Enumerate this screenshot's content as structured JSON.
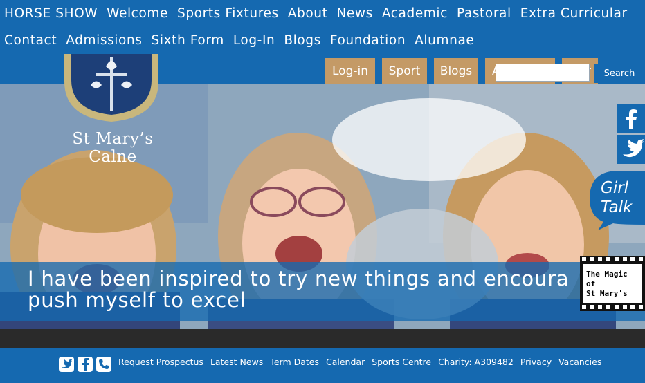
{
  "nav": {
    "row1": [
      "HORSE SHOW",
      "Welcome",
      "Sports Fixtures",
      "About",
      "News",
      "Academic",
      "Pastoral",
      "Extra Curricular"
    ],
    "row2": [
      "Contact",
      "Admissions",
      "Sixth Form",
      "Log-In",
      "Blogs",
      "Foundation",
      "Alumnae"
    ]
  },
  "quick_tabs": [
    "Log-in",
    "Sport",
    "Blogs",
    "A",
    "r"
  ],
  "search": {
    "button_label": "Search",
    "value": ""
  },
  "crest": {
    "line1": "St Mary’s",
    "line2": "Calne"
  },
  "hero": {
    "caption_line1": "I have been inspired to try new things and encoura",
    "caption_line2": "push myself to excel"
  },
  "side": {
    "girl_talk_line1": "Girl",
    "girl_talk_line2": "Talk",
    "magic_line1": "The Magic of",
    "magic_line2": "St Mary's"
  },
  "footer": {
    "links": [
      "Request Prospectus",
      "Latest News",
      "Term Dates",
      "Calendar",
      "Sports Centre",
      "Charity: A309482",
      "Privacy",
      "Vacancies"
    ]
  },
  "colors": {
    "brand_blue": "#1569b0",
    "tab_tan": "#c49a66",
    "dark_band": "#2a2a2a"
  }
}
